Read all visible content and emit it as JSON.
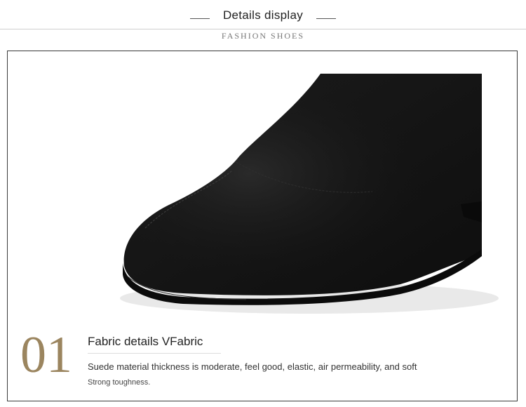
{
  "header": {
    "title": "Details display",
    "subtitle": "FASHION SHOES"
  },
  "section": {
    "number": "01",
    "title": "Fabric details VFabric",
    "description": "Suede material thickness is moderate, feel good, elastic, air permeability, and soft",
    "note": "Strong toughness."
  },
  "colors": {
    "accent": "#9b855f",
    "border": "#3a3a3a",
    "product": "#141414"
  },
  "image": {
    "subject": "shoe-photo"
  }
}
